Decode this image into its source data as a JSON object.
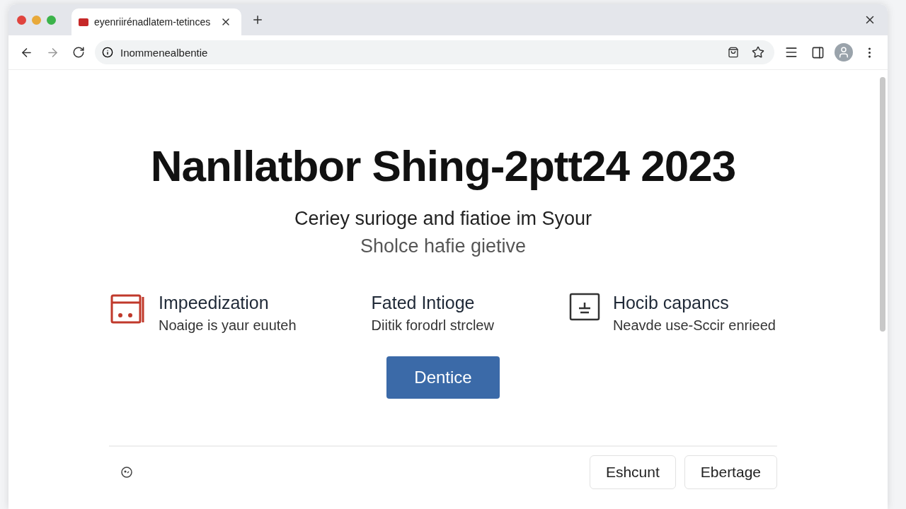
{
  "tabs": [
    {
      "title": "eyenriirénadlatem-tetinces",
      "selected": true
    }
  ],
  "address_bar": {
    "url": "Inommenealbentie"
  },
  "hero": {
    "title": "Nanllatbor Shing-2ptt24 2023",
    "subtitle": "Ceriey surioge and fiatioe im Syour",
    "tagline": "Sholce hafie gietive"
  },
  "features": [
    {
      "kind": "calendar",
      "title": "Impeedization",
      "text": "Noaige is yaur euuteh"
    },
    {
      "kind": "none",
      "title": "Fated Intioge",
      "text": "Diitik forodrl strclew"
    },
    {
      "kind": "screen",
      "title": "Hocib capancs",
      "text": "Neavde use-Sccir enrieed"
    }
  ],
  "primary_button": "Dentice",
  "footer_buttons": [
    "Eshcunt",
    "Ebertage"
  ]
}
